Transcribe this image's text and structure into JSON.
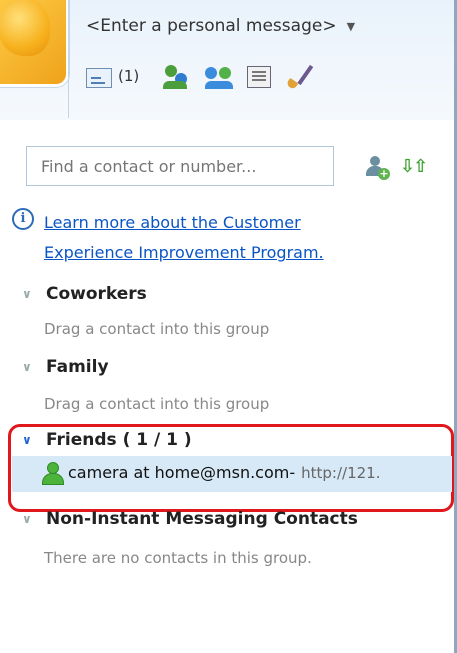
{
  "header": {
    "personal_message": "<Enter a personal message>",
    "mail_count": "(1)",
    "toolbar_icons": [
      "mail-icon",
      "contacts-icon",
      "group-icon",
      "games-icon",
      "customize-icon"
    ]
  },
  "search": {
    "placeholder": "Find a contact or number..."
  },
  "info": {
    "link_line1": "Learn more about the Customer",
    "link_line2": "Experience Improvement Program."
  },
  "groups": [
    {
      "name": "Coworkers",
      "empty_text": "Drag a contact into this group"
    },
    {
      "name": "Family",
      "empty_text": "Drag a contact into this group"
    },
    {
      "name": "Friends ( 1 / 1 )"
    },
    {
      "name": "Non-Instant Messaging Contacts",
      "empty_text": "There are no contacts in this group."
    }
  ],
  "contact": {
    "name": "camera at home@msn.com-",
    "status": "http://121."
  },
  "colors": {
    "link": "#0a55c6",
    "highlight_border": "#e0181b",
    "selected_row": "#d7e9f7"
  }
}
